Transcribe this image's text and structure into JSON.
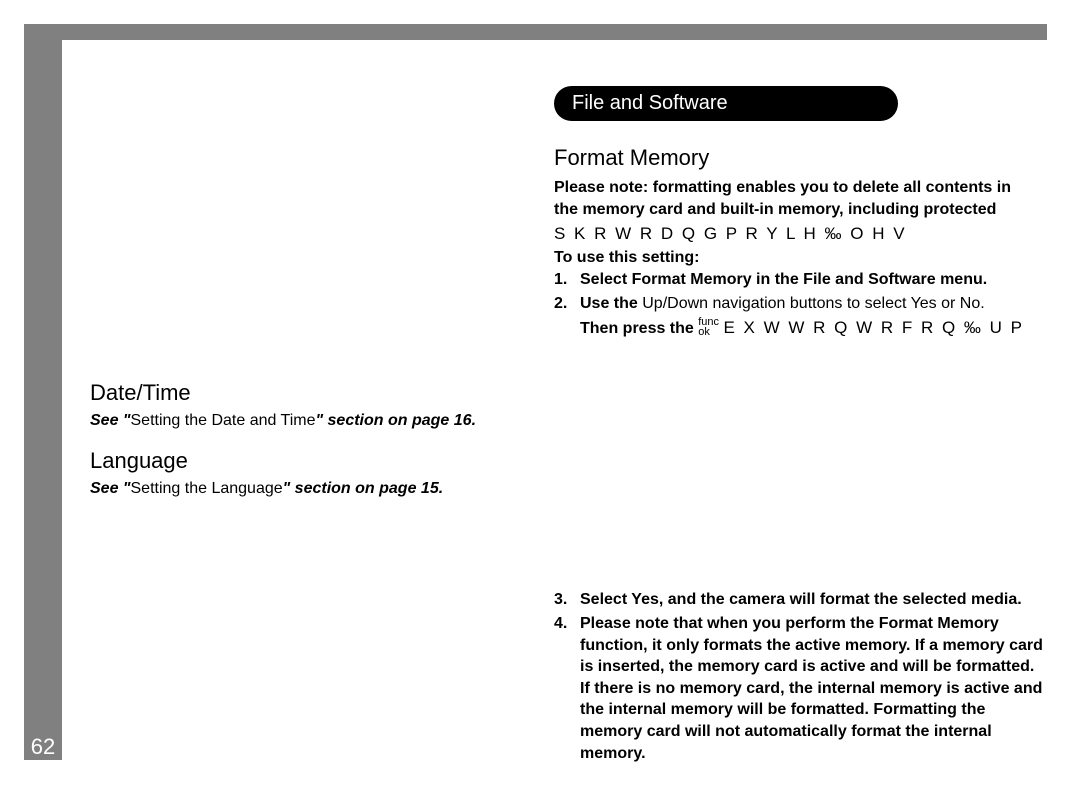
{
  "page_number": "62",
  "left": {
    "datetime_heading": "Date/Time",
    "datetime_ref_prefix": "See \"",
    "datetime_ref_title": "Setting the Date and Time",
    "datetime_ref_suffix": "\" section on page 16.",
    "language_heading": "Language",
    "language_ref_prefix": "See \"",
    "language_ref_title": "Setting the Language",
    "language_ref_suffix": "\" section on page 15."
  },
  "right": {
    "section_title": "File and Software",
    "format_heading": "Format Memory",
    "note_line1": "Please note:  formatting enables you to delete all contents in",
    "note_line2": "the memory card and built-in memory, including protected",
    "garbled_line": " S K R W R   D Q G   P R Y L H   ‰ O H V",
    "to_use": "To use this setting:",
    "step1": "Select Format Memory in the File and Software menu.",
    "step2_a": "Use the ",
    "step2_b_plain": "Up/Down navigation buttons to select Yes or No.",
    "step2_c": "Then press the ",
    "func": "func",
    "ok": "ok",
    "step2_garbled": "  E X W W R Q   W R   F R Q ‰ U P",
    "step3": "Select Yes, and the camera will format the selected media.",
    "step4": "Please note that when you perform the Format Memory function, it only formats the active memory. If a memory card is inserted, the memory card is active and will be formatted. If there is no memory card, the internal memory is active and the internal memory will be formatted. Formatting the memory card will not automatically format the internal memory."
  }
}
